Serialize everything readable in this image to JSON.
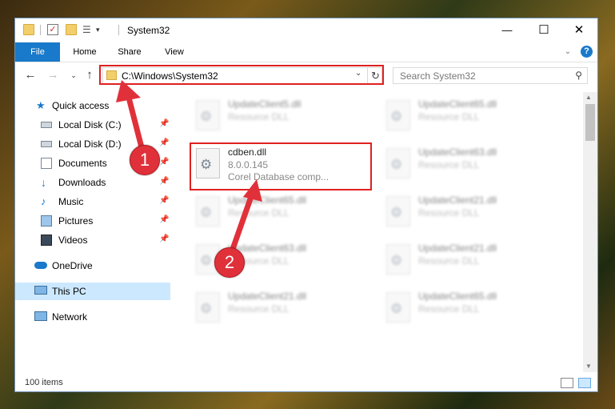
{
  "window": {
    "title": "System32",
    "controls": {
      "minimize": "—",
      "maximize": "☐",
      "close": "✕"
    }
  },
  "ribbon": {
    "tabs": [
      "File",
      "Home",
      "Share",
      "View"
    ],
    "expand_icon": "chevron-down-icon",
    "help_label": "?"
  },
  "nav": {
    "address": "C:\\Windows\\System32",
    "search_placeholder": "Search System32"
  },
  "sidebar": {
    "items": [
      {
        "label": "Quick access",
        "icon": "star-icon"
      },
      {
        "label": "Local Disk (C:)",
        "icon": "drive-icon",
        "pinned": true
      },
      {
        "label": "Local Disk (D:)",
        "icon": "drive-icon",
        "pinned": true
      },
      {
        "label": "Documents",
        "icon": "documents-icon",
        "pinned": true
      },
      {
        "label": "Downloads",
        "icon": "downloads-icon",
        "pinned": true
      },
      {
        "label": "Music",
        "icon": "music-icon",
        "pinned": true
      },
      {
        "label": "Pictures",
        "icon": "pictures-icon",
        "pinned": true
      },
      {
        "label": "Videos",
        "icon": "videos-icon",
        "pinned": true
      },
      {
        "label": "OneDrive",
        "icon": "cloud-icon"
      },
      {
        "label": "This PC",
        "icon": "computer-icon",
        "selected": true
      },
      {
        "label": "Network",
        "icon": "network-icon"
      }
    ]
  },
  "files": {
    "left": [
      {
        "name": "UpdateClient5.dll",
        "sub": "Resource DLL"
      },
      {
        "name": "cdben.dll",
        "sub": "8.0.0.145",
        "sub2": "Corel Database comp...",
        "highlighted": true
      },
      {
        "name": "UpdateClient65.dll",
        "sub": "Resource DLL"
      },
      {
        "name": "UpdateClient63.dll",
        "sub": "Resource DLL"
      },
      {
        "name": "UpdateClient21.dll",
        "sub": "Resource DLL"
      }
    ],
    "right": [
      {
        "name": "UpdateClient65.dll",
        "sub": "Resource DLL"
      },
      {
        "name": "UpdateClient63.dll",
        "sub": "Resource DLL"
      },
      {
        "name": "UpdateClient21.dll",
        "sub": "Resource DLL"
      },
      {
        "name": "UpdateClient21.dll",
        "sub": "Resource DLL"
      },
      {
        "name": "UpdateClient65.dll",
        "sub": "Resource DLL"
      }
    ]
  },
  "status": {
    "items_count": "100 items"
  },
  "annotations": {
    "step1": "1",
    "step2": "2",
    "color": "#e0313a"
  }
}
